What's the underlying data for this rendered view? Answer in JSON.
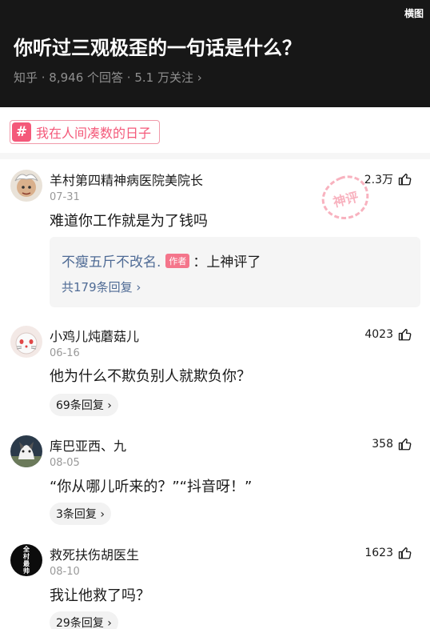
{
  "header": {
    "mode_label": "横图",
    "title": "你听过三观极歪的一句话是什么？",
    "meta": "知乎 · 8,946 个回答 · 5.1 万关注 ›"
  },
  "topic": {
    "icon": "hash-icon",
    "label": "我在人间凑数的日子"
  },
  "stamp_text": "神评",
  "comments": [
    {
      "name": "羊村第四精神病医院美院长",
      "date": "07-31",
      "text": "难道你工作就是为了钱吗",
      "likes": "2.3万",
      "reply": {
        "name": "不瘦五斤不改名.",
        "badge": "作者",
        "text": "：上神评了",
        "more": "共179条回复 ›"
      }
    },
    {
      "name": "小鸡儿炖蘑菇儿",
      "date": "06-16",
      "text": "他为什么不欺负别人就欺负你？",
      "likes": "4023",
      "replies": "69条回复 ›"
    },
    {
      "name": "库巴亚西、九",
      "date": "08-05",
      "text": "“你从哪儿听来的？”“抖音呀！”",
      "likes": "358",
      "replies": "3条回复 ›"
    },
    {
      "name": "救死扶伤胡医生",
      "date": "08-10",
      "text": "我让他救了吗？",
      "likes": "1623",
      "replies": "29条回复 ›",
      "avatar_text": "全村最帅"
    }
  ]
}
